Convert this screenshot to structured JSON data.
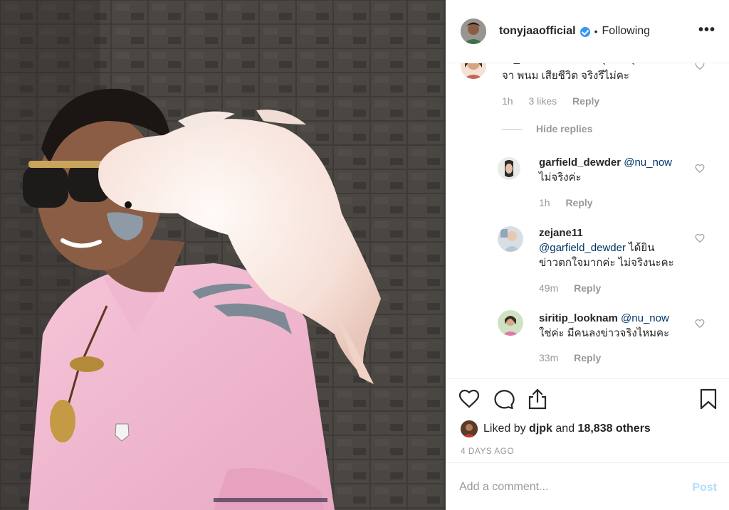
{
  "post": {
    "username": "tonyjaaofficial",
    "separator": "•",
    "follow_status": "Following",
    "more_label": "•••"
  },
  "comments": {
    "top": {
      "text_line1": "nu_now มีข่าวในเฟสบุ๊คว่า คุณ",
      "text_line2": "จา พนม เสียชีวิต จริงรึไม่คะ",
      "time": "1h",
      "likes": "3 likes",
      "reply": "Reply"
    },
    "hide_replies": "Hide replies",
    "replies": [
      {
        "username": "garfield_dewder",
        "mention": "@nu_now",
        "text": "ไม่จริงค่ะ",
        "time": "1h",
        "reply": "Reply"
      },
      {
        "username": "zejane11",
        "mention": "@garfield_dewder",
        "text_inline": "ได้ยิน",
        "text_line2": "ข่าวตกใจมากค่ะ ไม่จริงนะคะ",
        "time": "49m",
        "reply": "Reply"
      },
      {
        "username": "siritip_looknam",
        "mention": "@nu_now",
        "text": "ใช่ค่ะ มีคนลงข่าวจริงไหมคะ",
        "time": "33m",
        "reply": "Reply"
      }
    ]
  },
  "likes": {
    "prefix": "Liked by",
    "liker": "djpk",
    "and": "and",
    "others": "18,838 others"
  },
  "timeago": "4 DAYS AGO",
  "comment_box": {
    "placeholder": "Add a comment...",
    "post_label": "Post"
  },
  "colors": {
    "link": "#003569",
    "muted": "#999999",
    "verified": "#3897f0",
    "post_disabled": "#b2dffc"
  },
  "icons": [
    "heart-icon",
    "comment-icon",
    "share-icon",
    "bookmark-icon",
    "verified-icon",
    "more-icon"
  ]
}
